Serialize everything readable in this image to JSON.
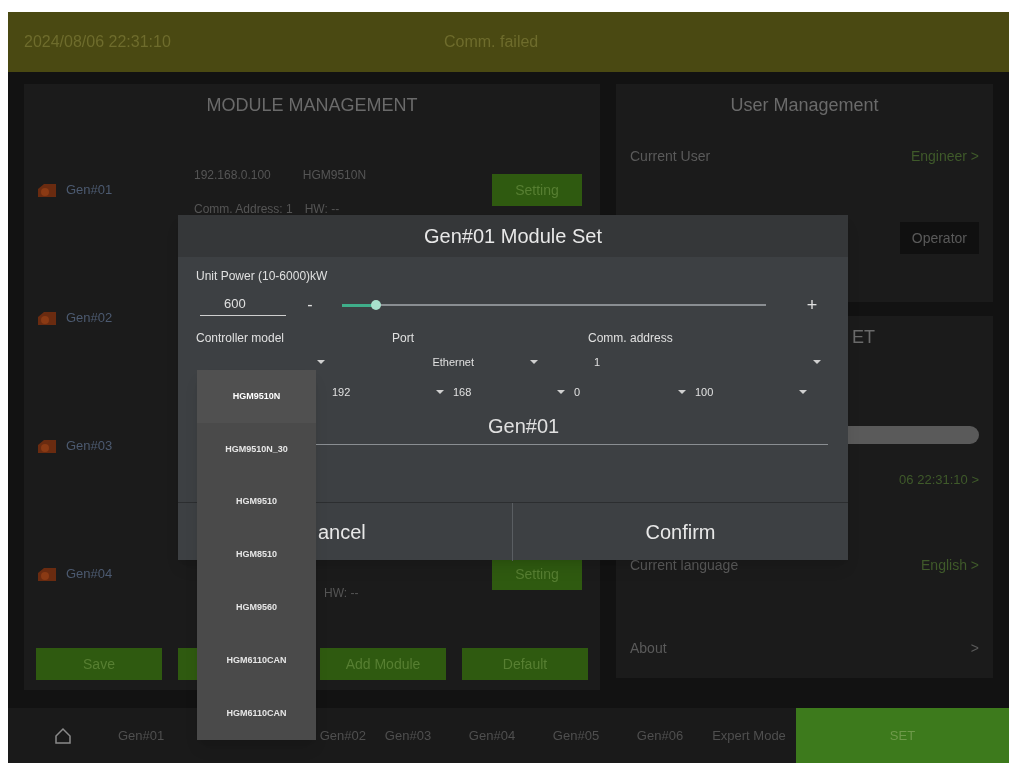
{
  "status_bar": {
    "datetime": "2024/08/06 22:31:10",
    "message": "Comm. failed"
  },
  "module_management": {
    "title": "MODULE MANAGEMENT",
    "modules": [
      {
        "name": "Gen#01",
        "ip": "192.168.0.100",
        "model": "HGM9510N",
        "address": "Comm. Address: 1",
        "hw": "HW: --",
        "button": "Setting"
      },
      {
        "name": "Gen#02"
      },
      {
        "name": "Gen#03"
      },
      {
        "name": "Gen#04",
        "hw": "HW: --",
        "button": "Setting"
      }
    ],
    "buttons": [
      {
        "kind": "labeled",
        "label": "Save"
      },
      {
        "kind": "covered"
      },
      {
        "kind": "labeled",
        "label": "Add Module"
      },
      {
        "kind": "labeled",
        "label": "Default"
      }
    ]
  },
  "user_management": {
    "title": "User Management",
    "current_user_label": "Current User",
    "current_user": "Engineer >",
    "operator_button": "Operator"
  },
  "system_set": {
    "title": "ET",
    "time_value": "06 22:31:10 >",
    "language_label": "Current language",
    "language": "English >",
    "about_label": "About",
    "about_value": ">"
  },
  "bottom_nav": [
    {
      "label": "Gen#01",
      "selected": false
    },
    {
      "label": "Gen#02",
      "selected": false
    },
    {
      "label": "Gen#03",
      "selected": false
    },
    {
      "label": "Gen#04",
      "selected": false
    },
    {
      "label": "Gen#05",
      "selected": false
    },
    {
      "label": "Gen#06",
      "selected": false
    },
    {
      "label": "Expert Mode",
      "selected": false
    },
    {
      "label": "SET",
      "selected": true
    }
  ],
  "dialog": {
    "title": "Gen#01 Module Set",
    "power_label": "Unit Power (10-6000)kW",
    "power_value": "600",
    "minus": "-",
    "plus": "+",
    "power_slider": {
      "level": 0.08
    },
    "controller_label": "Controller model",
    "port_label": "Port",
    "address_label": "Comm. address",
    "port_value": "Ethernet",
    "address_value": "1",
    "ip_parts": [
      "192",
      "168",
      "0",
      "100"
    ],
    "name_value": "Gen#01",
    "cancel": "ancel",
    "confirm": "Confirm"
  },
  "dropdown": {
    "options": [
      {
        "label": "HGM9510N",
        "selected": true
      },
      {
        "label": "HGM9510N_30",
        "selected": false
      },
      {
        "label": "HGM9510",
        "selected": false
      },
      {
        "label": "HGM8510",
        "selected": false
      },
      {
        "label": "HGM9560",
        "selected": false
      },
      {
        "label": "HGM6110CAN",
        "selected": false
      },
      {
        "label": "HGM6110CAN",
        "selected": false
      }
    ]
  }
}
